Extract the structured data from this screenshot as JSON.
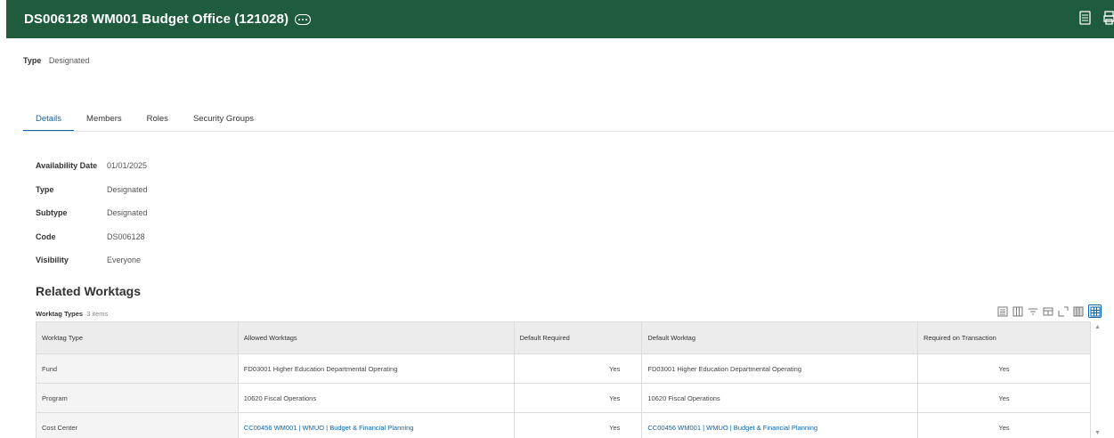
{
  "header": {
    "title": "DS006128 WM001 Budget Office (121028)",
    "bg_color": "#1f5c3d",
    "icons": [
      "related-actions-icon",
      "export-excel-icon",
      "print-icon"
    ]
  },
  "summary": {
    "type_label": "Type",
    "type_value": "Designated"
  },
  "tabs": [
    {
      "label": "Details",
      "active": true
    },
    {
      "label": "Members"
    },
    {
      "label": "Roles"
    },
    {
      "label": "Security Groups"
    }
  ],
  "details": [
    {
      "label": "Availability Date",
      "value": "01/01/2025"
    },
    {
      "label": "Type",
      "value": "Designated"
    },
    {
      "label": "Subtype",
      "value": "Designated"
    },
    {
      "label": "Code",
      "value": "DS006128"
    },
    {
      "label": "Visibility",
      "value": "Everyone"
    }
  ],
  "related": {
    "title": "Related Worktags",
    "grid_title": "Worktag Types",
    "grid_count": "3 items",
    "columns": [
      "Worktag Type",
      "Allowed Worktags",
      "Default Required",
      "Default Worktag",
      "Required on Transaction"
    ],
    "rows": [
      {
        "type": "Fund",
        "allowed": "FD03001 Higher Education Departmental Operating",
        "default_required": "Yes",
        "default_worktag": "FD03001 Higher Education Departmental Operating",
        "required": "Yes",
        "linked": false
      },
      {
        "type": "Program",
        "allowed": "10620 Fiscal Operations",
        "default_required": "Yes",
        "default_worktag": "10620 Fiscal Operations",
        "required": "Yes",
        "linked": false
      },
      {
        "type": "Cost Center",
        "allowed": "CC00456 WM001 | WMUO | Budget & Financial Planning",
        "default_required": "Yes",
        "default_worktag": "CC00456 WM001 | WMUO | Budget & Financial Planning",
        "required": "Yes",
        "linked": true
      }
    ],
    "toolbar_icons": [
      "export-excel-icon",
      "columns-icon",
      "filter-icon",
      "view-icon",
      "fullscreen-icon",
      "table-view-icon",
      "grid-view-icon"
    ]
  },
  "accent_color": "#0b63ab"
}
